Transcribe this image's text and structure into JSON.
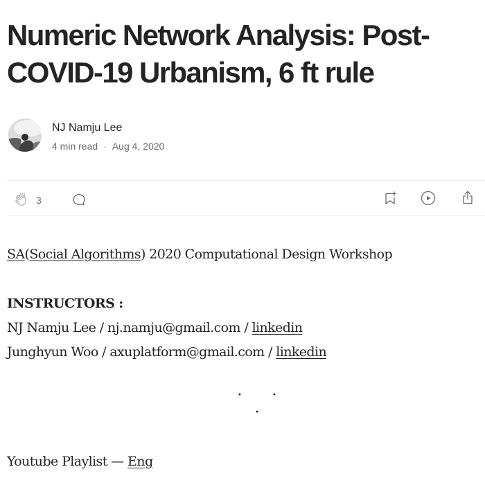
{
  "article": {
    "title": "Numeric Network Analysis: Post-COVID-19 Urbanism, 6 ft rule"
  },
  "author": {
    "name": "NJ Namju Lee",
    "read_time": "4 min read",
    "separator": "·",
    "date": "Aug 4, 2020"
  },
  "actions": {
    "clap_count": "3",
    "icons": [
      "clap-icon",
      "comment-icon",
      "bookmark-add-icon",
      "play-icon",
      "share-icon"
    ]
  },
  "body": {
    "line1": {
      "sa_link": "SA",
      "paren_open": "(",
      "social_link": "Social Algorithms",
      "rest": ") 2020 Computational Design Workshop"
    },
    "instructors_heading": "INSTRUCTORS :",
    "instructor1": {
      "text": "NJ Namju Lee / nj.namju@gmail.com / ",
      "link": "linkedin"
    },
    "instructor2": {
      "text": "Junghyun Woo / axuplatform@gmail.com / ",
      "link": "linkedin"
    },
    "separator": "· · ·",
    "playlist": {
      "text": "Youtube Playlist — ",
      "link": "Eng"
    }
  },
  "colors": {
    "text": "#242424",
    "muted": "#6b6b6b",
    "divider": "#f0f0f0"
  }
}
